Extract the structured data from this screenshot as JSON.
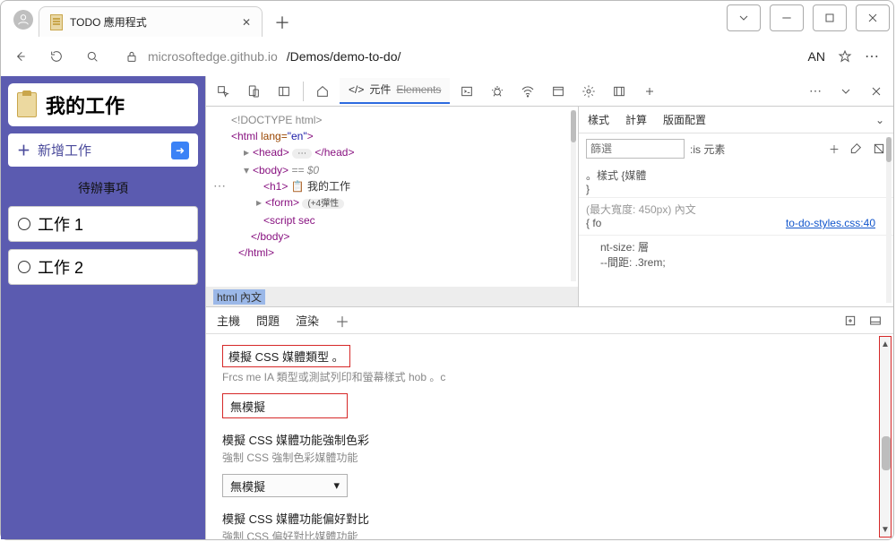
{
  "browser": {
    "tab_title": "TODO 應用程式",
    "url_host": "microsoftedge.github.io",
    "url_path": "/Demos/demo-to-do/",
    "profile": "AN"
  },
  "app": {
    "title": "我的工作",
    "add_label": "新增工作",
    "section": "待辦事項",
    "tasks": [
      "工作 1",
      "工作 2"
    ]
  },
  "devtools": {
    "elements_tab": "元件",
    "elements_strike": "Elements",
    "dom": {
      "doctype": "<!DOCTYPE html>",
      "html_open": "<html lang=\"en\">",
      "head": "<head>",
      "head_close": "</head>",
      "body": "<body>",
      "body_eq": "== $0",
      "h1": "<h1>",
      "h1_text": "我的工作",
      "form": "<form>",
      "form_badge": "(+4彈性",
      "script": "<script sec",
      "body_close": "</body>",
      "html_close": "</html>",
      "ellipsis": "⋯"
    },
    "breadcrumb": {
      "a": "html",
      "b": "內文"
    },
    "styles": {
      "tabs": [
        "樣式",
        "計算",
        "版面配置"
      ],
      "filter_ph": "篩選",
      "is_el": ":is 元素",
      "rule1a": "。樣式 {媒體",
      "rule1b": "}",
      "mq": "(最大寬度: 450px) 內文",
      "link": "to-do-styles.css:40",
      "decl1": "nt-size:         層",
      "decl2": "--間距: .3rem;",
      "fo": "{ fo"
    },
    "drawer": {
      "tabs": [
        "主機",
        "問題",
        "渲染"
      ],
      "line1": "模擬 CSS 媒體類型 。",
      "line1_sub": "Frcs me IA 類型或測試列印和螢幕樣式 hob 。c",
      "select1": "無模擬",
      "line2a": "模擬 CSS 媒體功能強制色彩",
      "line2b": "強制 CSS 強制色彩媒體功能",
      "select2": "無模擬",
      "line3a": "模擬 CSS 媒體功能偏好對比",
      "line3b": "強制 CSS 偏好對比媒體功能"
    }
  }
}
